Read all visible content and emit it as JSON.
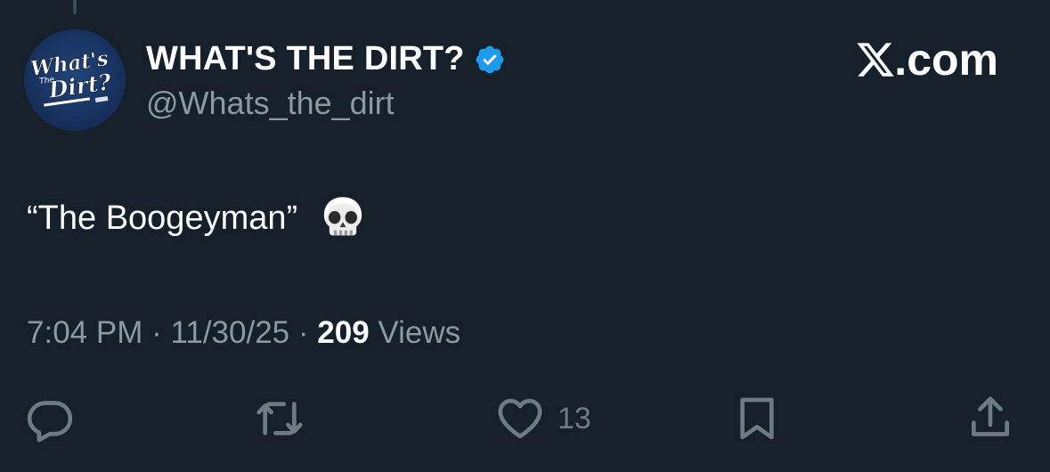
{
  "post": {
    "display_name": "WHAT'S THE DIRT?",
    "handle": "@Whats_the_dirt",
    "text": "“The Boogeyman”",
    "time": "7:04 PM",
    "separator": "·",
    "date": "11/30/25",
    "views_count": "209",
    "views_label": "Views"
  },
  "avatar": {
    "line1": "What's",
    "line2": "The",
    "line3": "Dirt?"
  },
  "brand": {
    "suffix": ".com"
  },
  "actions": {
    "like_count": "13"
  },
  "colors": {
    "background": "#15202b",
    "verified": "#1d9bf0",
    "secondary_text": "#8b98a5",
    "action_icon": "#6e7a86"
  },
  "icons": {
    "verified": "verified-badge-icon",
    "reply": "reply-icon",
    "repost": "repost-icon",
    "like": "heart-icon",
    "bookmark": "bookmark-icon",
    "share": "share-icon",
    "emoji": "skull-icon"
  }
}
